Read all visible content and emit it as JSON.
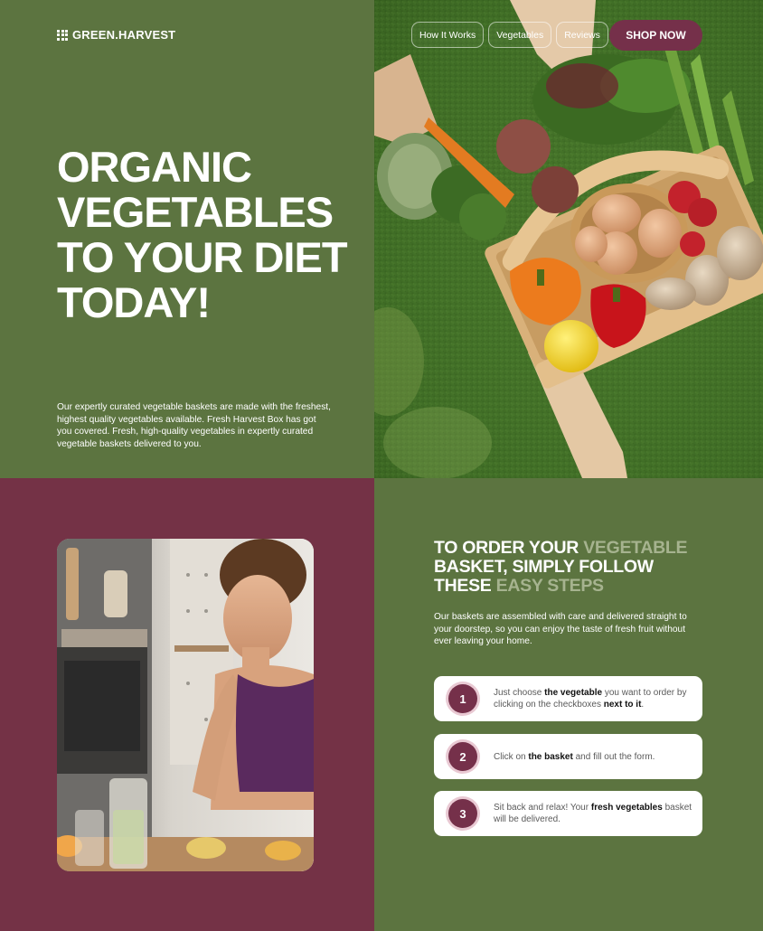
{
  "brand": {
    "name": "GREEN.HARVEST",
    "icon": "grid-icon"
  },
  "nav": {
    "items": [
      {
        "label": "How It Works"
      },
      {
        "label": "Vegetables"
      },
      {
        "label": "Reviews"
      }
    ],
    "cta_label": "SHOP NOW"
  },
  "hero": {
    "title_lines": [
      "ORGANIC",
      "VEGETABLES",
      "TO YOUR DIET",
      "TODAY!"
    ],
    "description": "Our expertly curated vegetable baskets are made with the freshest, highest quality vegetables available. Fresh Harvest Box has got you covered. Fresh, high-quality vegetables in expertly curated vegetable baskets delivered to you."
  },
  "steps_section": {
    "title_parts": {
      "p1": "TO ORDER YOUR ",
      "p2": "VEGETABLE",
      "p3": "BASKET, SIMPLY FOLLOW",
      "p4": "THESE ",
      "p5": "EASY STEPS"
    },
    "description": "Our baskets are assembled with care and delivered straight to your doorstep, so you can enjoy the taste of fresh fruit without ever leaving your home.",
    "steps": [
      {
        "number": "1",
        "t1": "Just choose ",
        "b1": "the vegetable",
        "t2": " you want to order by clicking on the checkboxes ",
        "b2": "next to it",
        "t3": "."
      },
      {
        "number": "2",
        "t1": "Click on ",
        "b1": "the basket",
        "t2": " and fill out the form.",
        "b2": "",
        "t3": ""
      },
      {
        "number": "3",
        "t1": "Sit back and relax! Your ",
        "b1": "fresh vegetables",
        "t2": " basket will be delivered.",
        "b2": "",
        "t3": ""
      }
    ]
  },
  "colors": {
    "green": "#5c7440",
    "maroon": "#743246",
    "accent_muted": "#a6b38f",
    "white": "#ffffff"
  }
}
